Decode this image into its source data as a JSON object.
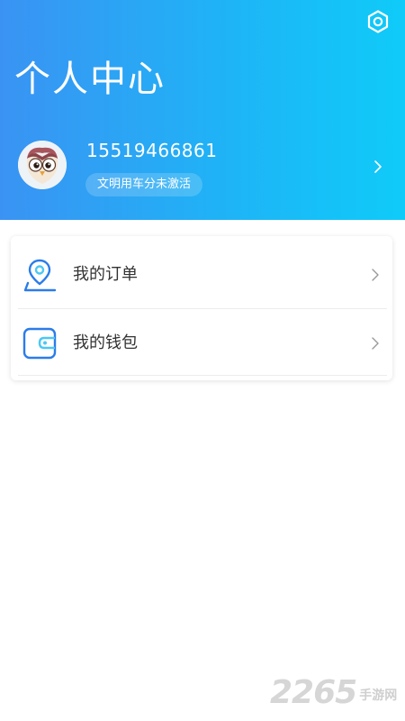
{
  "header": {
    "title": "个人中心",
    "settings_icon": "gear-icon",
    "gradient_colors": [
      "#3a93f3",
      "#0fcbf9"
    ]
  },
  "profile": {
    "avatar_icon": "owl-avatar",
    "phone": "15519466861",
    "badge": "文明用车分未激活",
    "chevron_icon": "chevron-right-icon"
  },
  "menu": {
    "items": [
      {
        "label": "我的订单",
        "icon": "location-pin-icon",
        "chevron_icon": "chevron-right-icon"
      },
      {
        "label": "我的钱包",
        "icon": "wallet-icon",
        "chevron_icon": "chevron-right-icon"
      }
    ],
    "icon_colors": [
      "#2b7ce9",
      "#4bc8f3"
    ]
  },
  "watermark": {
    "number": "2265",
    "text": "手游网"
  }
}
